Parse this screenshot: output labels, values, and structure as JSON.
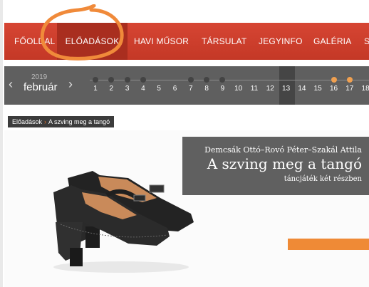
{
  "nav": {
    "items": [
      {
        "label": "FŐOLDAL",
        "active": false
      },
      {
        "label": "ELŐADÁSOK",
        "active": true
      },
      {
        "label": "HAVI MŰSOR",
        "active": false
      },
      {
        "label": "TÁRSULAT",
        "active": false
      },
      {
        "label": "JEGYINFO",
        "active": false
      },
      {
        "label": "GALÉRIA",
        "active": false
      },
      {
        "label": "S",
        "active": false
      }
    ],
    "colors": {
      "bar": "#d04030",
      "active": "#a92e1f",
      "text": "#ffffff"
    }
  },
  "calendar": {
    "year": "2019",
    "month": "február",
    "prev_icon": "‹",
    "next_icon": "›",
    "days": [
      "1",
      "2",
      "3",
      "4",
      "5",
      "6",
      "7",
      "8",
      "9",
      "10",
      "11",
      "12",
      "13",
      "14",
      "15",
      "16",
      "17",
      "18"
    ],
    "event_days": [
      "1",
      "2",
      "3",
      "4",
      "7",
      "8",
      "9"
    ],
    "highlighted_event_days": [
      "16",
      "17"
    ],
    "current_day": "13",
    "colors": {
      "bar": "#5f5f5f",
      "dot": "#444444",
      "highlight_dot": "#f0a050"
    }
  },
  "breadcrumb": {
    "parent": "Előadások",
    "separator": "›",
    "current": "A szving meg a tangó"
  },
  "show": {
    "authors": "Demcsák Ottó–Rovó Péter–Szakál Attila",
    "title": "A szving meg a tangó",
    "subtitle": "táncjáték két részben"
  },
  "colors": {
    "accent": "#ef8a36",
    "annotation": "#f08a3a"
  }
}
